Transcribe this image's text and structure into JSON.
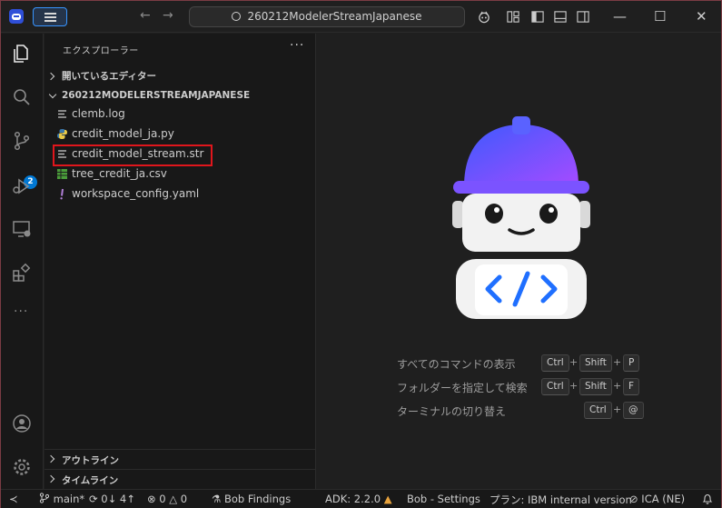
{
  "titlebar": {
    "search_text": "260212ModelerStreamJapanese",
    "back_arrow": "←",
    "forward_arrow": "→",
    "minimize": "—",
    "maximize": "☐",
    "close": "✕"
  },
  "activitybar": {
    "items": [
      "explorer-icon",
      "search-icon",
      "source-control-icon",
      "run-debug-icon",
      "remote-explorer-icon",
      "extensions-icon",
      "more-icon",
      "account-icon",
      "settings-icon"
    ],
    "source_control_badge": "2",
    "more_label": "···"
  },
  "sidebar": {
    "title": "エクスプローラー",
    "more": "···",
    "open_editors": "開いているエディター",
    "folder": "260212MODELERSTREAMJAPANESE",
    "files": [
      {
        "name": "clemb.log",
        "icon": "lines-icon"
      },
      {
        "name": "credit_model_ja.py",
        "icon": "python-icon"
      },
      {
        "name": "credit_model_stream.str",
        "icon": "lines-icon"
      },
      {
        "name": "tree_credit_ja.csv",
        "icon": "csv-icon"
      },
      {
        "name": "workspace_config.yaml",
        "icon": "yaml-icon"
      }
    ],
    "outline": "アウトライン",
    "timeline": "タイムライン"
  },
  "editor": {
    "shortcuts": [
      {
        "label": "すべてのコマンドの表示",
        "keys": [
          "Ctrl",
          "Shift",
          "P"
        ]
      },
      {
        "label": "フォルダーを指定して検索",
        "keys": [
          "Ctrl",
          "Shift",
          "F"
        ]
      },
      {
        "label": "ターミナルの切り替え",
        "keys": [
          "Ctrl",
          "@"
        ]
      }
    ],
    "plus": "+"
  },
  "statusbar": {
    "remote": "≺",
    "branch": "main*",
    "sync": "0↓ 4↑",
    "errors": "0",
    "warnings": "0",
    "findings": "Bob Findings",
    "adk": "ADK: 2.2.0",
    "settings": "Bob - Settings",
    "plan": "プラン: IBM internal version",
    "ica": "ICA (NE)"
  },
  "colors": {
    "accent": "#0078d4",
    "highlight_box": "#e0161c",
    "helmet_top": "#3d5afe",
    "helmet_bottom": "#a64bff",
    "code_icon": "#1f6fff"
  }
}
